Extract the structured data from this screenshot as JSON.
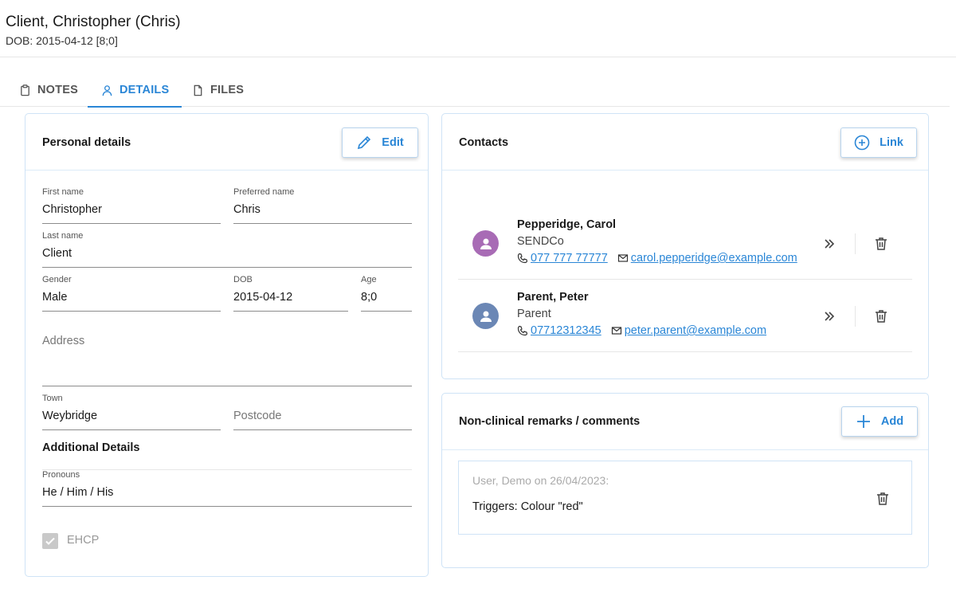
{
  "client": {
    "name": "Client, Christopher (Chris)",
    "dob_line": "DOB: 2015-04-12 [8;0]"
  },
  "tabs": [
    {
      "label": "NOTES",
      "icon": "clipboard-icon",
      "active": false
    },
    {
      "label": "DETAILS",
      "icon": "person-icon",
      "active": true
    },
    {
      "label": "FILES",
      "icon": "file-icon",
      "active": false
    }
  ],
  "personal": {
    "title": "Personal details",
    "edit_label": "Edit",
    "first_name": {
      "label": "First name",
      "value": "Christopher"
    },
    "preferred_name": {
      "label": "Preferred name",
      "value": "Chris"
    },
    "last_name": {
      "label": "Last name",
      "value": "Client"
    },
    "gender": {
      "label": "Gender",
      "value": "Male"
    },
    "dob": {
      "label": "DOB",
      "value": "2015-04-12"
    },
    "age": {
      "label": "Age",
      "value": "8;0"
    },
    "address": {
      "placeholder": "Address"
    },
    "town": {
      "label": "Town",
      "value": "Weybridge"
    },
    "postcode": {
      "placeholder": "Postcode"
    },
    "additional_title": "Additional Details",
    "pronouns": {
      "label": "Pronouns",
      "value": "He / Him / His"
    },
    "ehcp": {
      "label": "EHCP",
      "checked": true
    }
  },
  "contacts": {
    "title": "Contacts",
    "link_label": "Link",
    "items": [
      {
        "name": "Pepperidge, Carol",
        "role": "SENDCo",
        "phone": "077 777 77777",
        "email": "carol.pepperidge@example.com",
        "avatar_color": "#a86bb5"
      },
      {
        "name": "Parent, Peter",
        "role": "Parent",
        "phone": "07712312345",
        "email": "peter.parent@example.com",
        "avatar_color": "#6b87b5"
      }
    ]
  },
  "remarks": {
    "title": "Non-clinical remarks / comments",
    "add_label": "Add",
    "items": [
      {
        "meta": "User, Demo on 26/04/2023:",
        "text": "Triggers: Colour \"red\""
      }
    ]
  },
  "colors": {
    "accent": "#2a86d6",
    "border": "#cfe3f6"
  }
}
